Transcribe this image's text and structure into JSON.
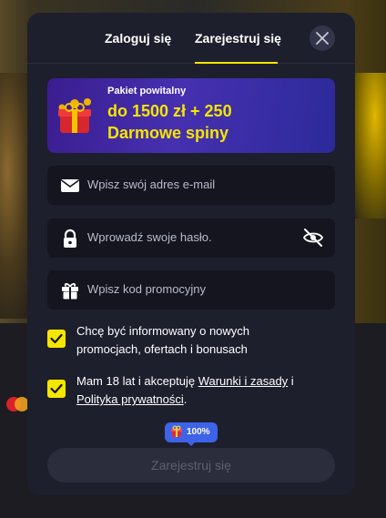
{
  "tabs": {
    "login": "Zaloguj się",
    "register": "Zarejestruj się",
    "active": "register"
  },
  "promo": {
    "small": "Pakiet powitalny",
    "line1": "do 1500 zł + 250",
    "line2": "Darmowe spiny"
  },
  "fields": {
    "email_placeholder": "Wpisz swój adres e-mail",
    "password_placeholder": "Wprowadź swoje hasło.",
    "promo_placeholder": "Wpisz kod promocyjny"
  },
  "checks": {
    "marketing": {
      "checked": true,
      "line1": "Chcę być informowany o nowych",
      "line2": "promocjach, ofertach i bonusach"
    },
    "terms": {
      "checked": true,
      "prefix": "Mam 18 lat i akceptuję ",
      "terms_link": "Warunki i zasady",
      "mid": " i",
      "privacy_link": "Polityka prywatności",
      "suffix": "."
    }
  },
  "progress": {
    "label": "100%",
    "value": 100
  },
  "submit_label": "Zarejestruj się",
  "colors": {
    "accent": "#f5e600",
    "modal_bg": "#1e1f2d",
    "field_bg": "#14151f",
    "badge_blue": "#3d63e8"
  },
  "icons": {
    "close": "close-icon",
    "email": "envelope-icon",
    "password": "lock-icon",
    "eye": "eye-off-icon",
    "promo": "gift-icon"
  }
}
